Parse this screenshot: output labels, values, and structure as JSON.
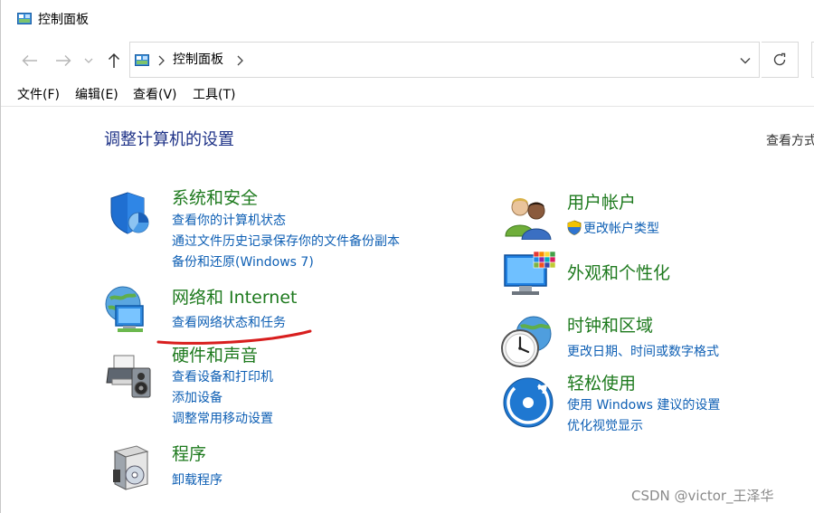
{
  "window": {
    "title": "控制面板"
  },
  "address": {
    "path": "控制面板"
  },
  "menu": {
    "file": "文件(F)",
    "edit": "编辑(E)",
    "view": "查看(V)",
    "tools": "工具(T)"
  },
  "main": {
    "title": "调整计算机的设置",
    "view_by": "查看方式"
  },
  "categories": {
    "system_security": {
      "title": "系统和安全",
      "links": [
        "查看你的计算机状态",
        "通过文件历史记录保存你的文件备份副本",
        "备份和还原(Windows 7)"
      ]
    },
    "network": {
      "title": "网络和 Internet",
      "links": [
        "查看网络状态和任务"
      ]
    },
    "hardware": {
      "title": "硬件和声音",
      "links": [
        "查看设备和打印机",
        "添加设备",
        "调整常用移动设置"
      ]
    },
    "programs": {
      "title": "程序",
      "links": [
        "卸载程序"
      ]
    },
    "user_accounts": {
      "title": "用户帐户",
      "links": [
        "更改帐户类型"
      ]
    },
    "appearance": {
      "title": "外观和个性化",
      "links": []
    },
    "clock_region": {
      "title": "时钟和区域",
      "links": [
        "更改日期、时间或数字格式"
      ]
    },
    "ease": {
      "title": "轻松使用",
      "links": [
        "使用 Windows 建议的设置",
        "优化视觉显示"
      ]
    }
  },
  "watermark": "CSDN @victor_王泽华",
  "colors": {
    "title_blue": "#1e3287",
    "category_green": "#1e7a1e",
    "link_blue": "#0e5fb4",
    "annotation_red": "#d81e1e"
  }
}
